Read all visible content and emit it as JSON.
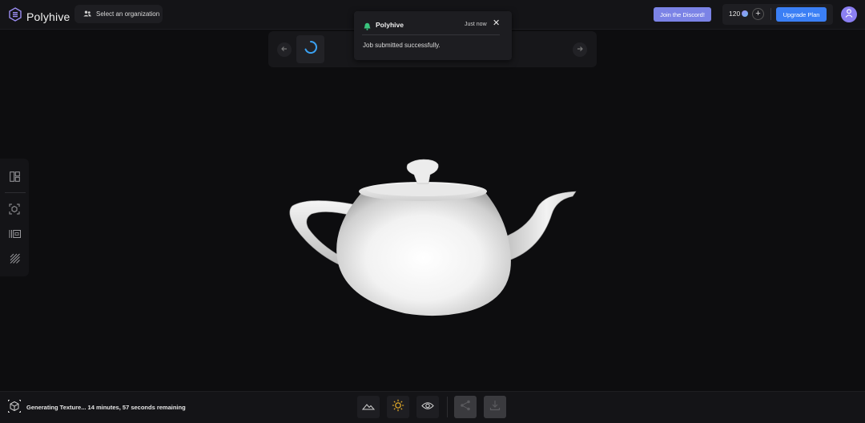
{
  "header": {
    "app_name": "Polyhive",
    "org_button": "Select an organization",
    "discord_button": "Join the Discord!",
    "credits": "120",
    "plus": "+",
    "upgrade_button": "Upgrade Plan"
  },
  "toast": {
    "title": "Polyhive",
    "time": "Just now",
    "close": "✕",
    "message": "Job submitted successfully."
  },
  "status": {
    "text": "Generating Texture... 14 minutes, 57 seconds remaining"
  },
  "colors": {
    "accent": "#3b7ff5",
    "discord": "#7b83e6",
    "avatar": "#8b7ff3",
    "spinner": "#3aa0f0",
    "bell": "#3ac47d"
  },
  "icons": {
    "sidebar": [
      "layout-icon",
      "focus-object-icon",
      "uv-map-icon",
      "texture-stripes-icon"
    ],
    "toolbar": [
      "landscape-icon",
      "sun-icon",
      "eye-icon",
      "share-icon",
      "download-icon"
    ]
  }
}
